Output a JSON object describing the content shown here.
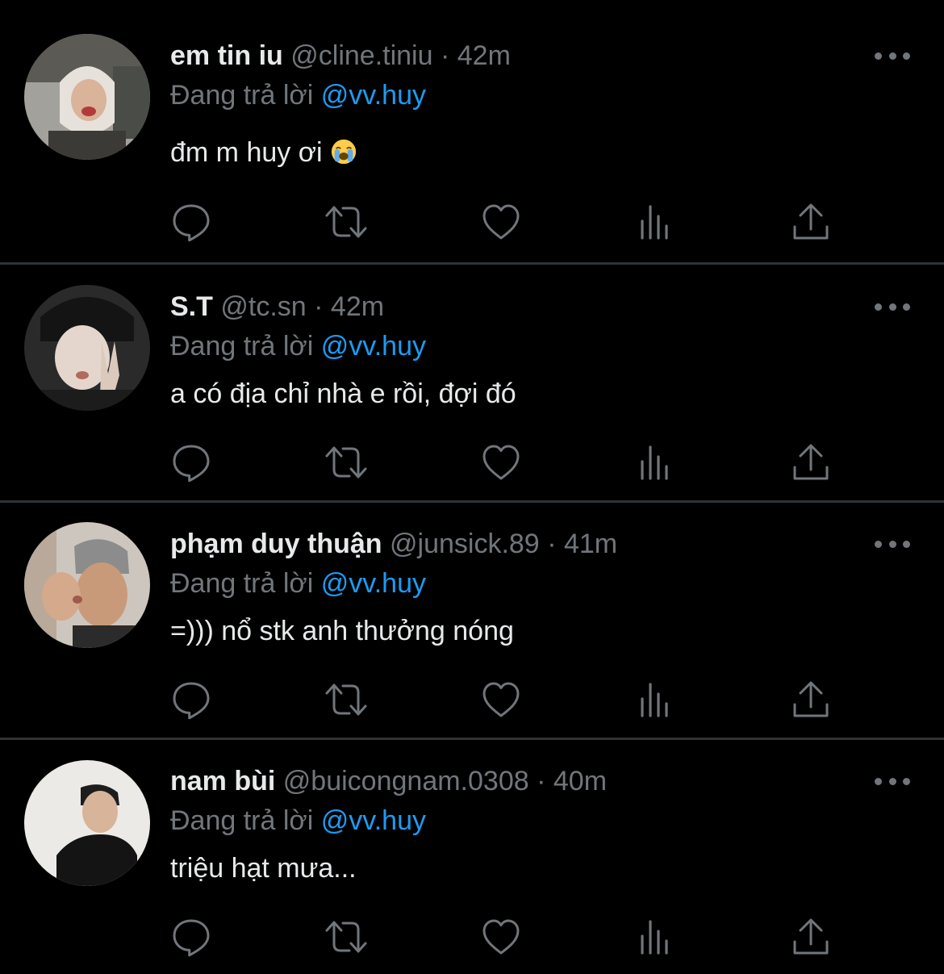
{
  "tweets": [
    {
      "display_name": "em tin iu",
      "handle": "@cline.tiniu",
      "separator": "·",
      "time": "42m",
      "reply_prefix": "Đang trả lời",
      "reply_to": "@vv.huy",
      "text": "đm m huy ơi",
      "emoji": "loudly-crying-face"
    },
    {
      "display_name": "S.T",
      "handle": "@tc.sn",
      "separator": "·",
      "time": "42m",
      "reply_prefix": "Đang trả lời",
      "reply_to": "@vv.huy",
      "text": "a có địa chỉ nhà e rồi, đợi đó"
    },
    {
      "display_name": "phạm duy thuận",
      "handle": "@junsick.89",
      "separator": "·",
      "time": "41m",
      "reply_prefix": "Đang trả lời",
      "reply_to": "@vv.huy",
      "text": "=))) nổ stk anh thưởng nóng"
    },
    {
      "display_name": "nam bùi",
      "handle": "@buicongnam.0308",
      "separator": "·",
      "time": "40m",
      "reply_prefix": "Đang trả lời",
      "reply_to": "@vv.huy",
      "text": "triệu hạt mưa..."
    }
  ],
  "action_icons": [
    "reply-icon",
    "retweet-icon",
    "like-icon",
    "views-icon",
    "share-icon"
  ],
  "more_icon": "more-options-icon",
  "colors": {
    "background": "#000000",
    "primary_text": "#e7e9ea",
    "secondary_text": "#71767b",
    "link": "#1d9bf0",
    "divider": "#2f3336"
  }
}
